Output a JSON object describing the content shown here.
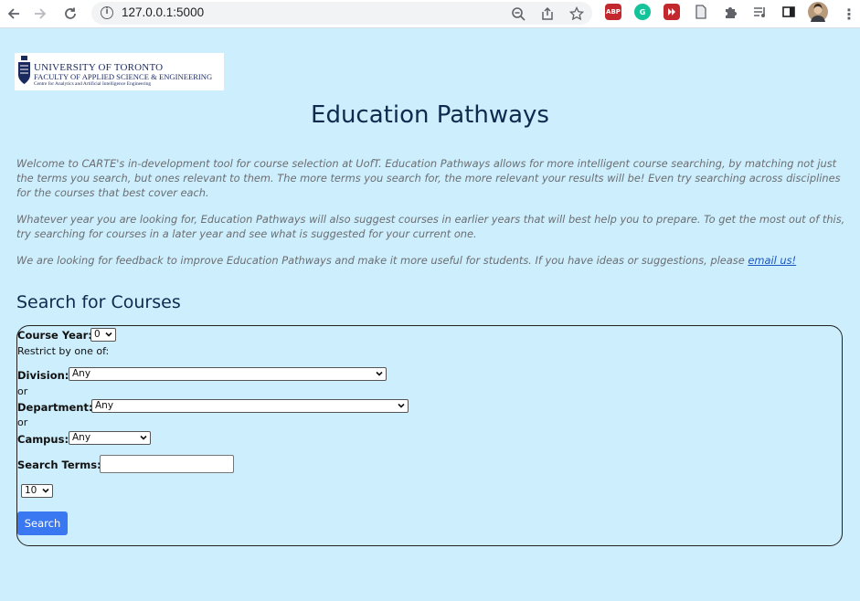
{
  "browser": {
    "url": "127.0.0.1:5000",
    "back_icon": "arrow-left-icon",
    "forward_icon": "arrow-right-icon",
    "reload_icon": "reload-icon",
    "extensions": [
      "ABP",
      "G"
    ]
  },
  "logo": {
    "line1": "UNIVERSITY OF TORONTO",
    "line2": "FACULTY OF APPLIED SCIENCE & ENGINEERING",
    "line3": "Centre for Analytics and Artificial Intelligence Engineering"
  },
  "page": {
    "title": "Education Pathways",
    "intro1": "Welcome to CARTE's in-development tool for course selection at UofT. Education Pathways allows for more intelligent course searching, by matching not just the terms you search, but ones relevant to them. The more terms you search for, the more relevant your results will be! Even try searching across disciplines for the courses that best cover each.",
    "intro2": "Whatever year you are looking for, Education Pathways will also suggest courses in earlier years that will best help you to prepare. To get the most out of this, try searching for courses in a later year and see what is suggested for your current one.",
    "intro3": "We are looking for feedback to improve Education Pathways and make it more useful for students. If you have ideas or suggestions, please ",
    "email_link": "email us!"
  },
  "form": {
    "section_title": "Search for Courses",
    "course_year_label": "Course Year:",
    "course_year_value": "0",
    "restrict_text": "Restrict by one of:",
    "division_label": "Division:",
    "division_value": "Any",
    "or1": "or",
    "department_label": "Department:",
    "department_value": "Any",
    "or2": "or",
    "campus_label": "Campus:",
    "campus_value": "Any",
    "search_terms_label": "Search Terms:",
    "search_terms_value": "",
    "results_count_value": "10",
    "search_button": "Search"
  }
}
